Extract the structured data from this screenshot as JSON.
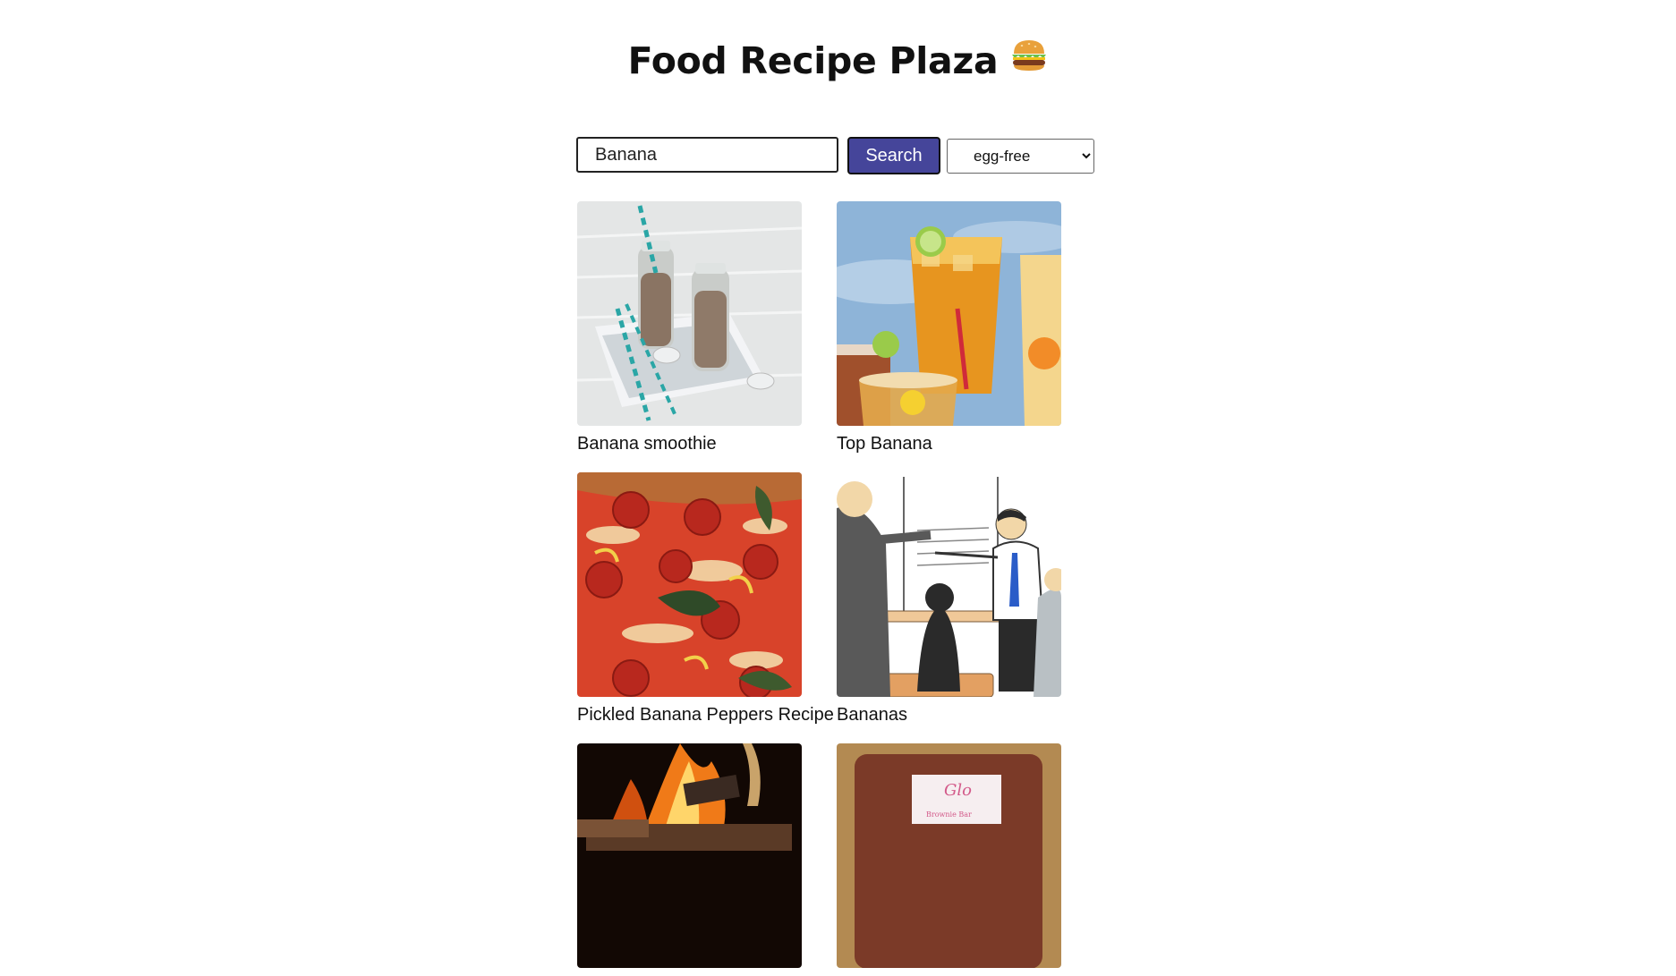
{
  "page": {
    "title": "Food Recipe Plaza",
    "title_icon": "burger-icon"
  },
  "search": {
    "value": "Banana",
    "button_label": "Search",
    "filter_selected": "egg-free",
    "colors": {
      "button_bg": "#45459a",
      "button_text": "#ffffff"
    }
  },
  "recipes": [
    {
      "label": "Banana smoothie",
      "image": "banana-smoothie-image"
    },
    {
      "label": "Top Banana",
      "image": "iced-tea-drinks-image"
    },
    {
      "label": "Pickled Banana Peppers Recipe",
      "image": "pepperoni-pizza-image"
    },
    {
      "label": "Bananas",
      "image": "presentation-illustration-image"
    },
    {
      "label": "",
      "image": "campfire-image"
    },
    {
      "label": "",
      "image": "packaged-bar-image"
    }
  ],
  "packaged_bar_text": {
    "brand": "Glo",
    "subtitle": "Brownie Bar"
  }
}
